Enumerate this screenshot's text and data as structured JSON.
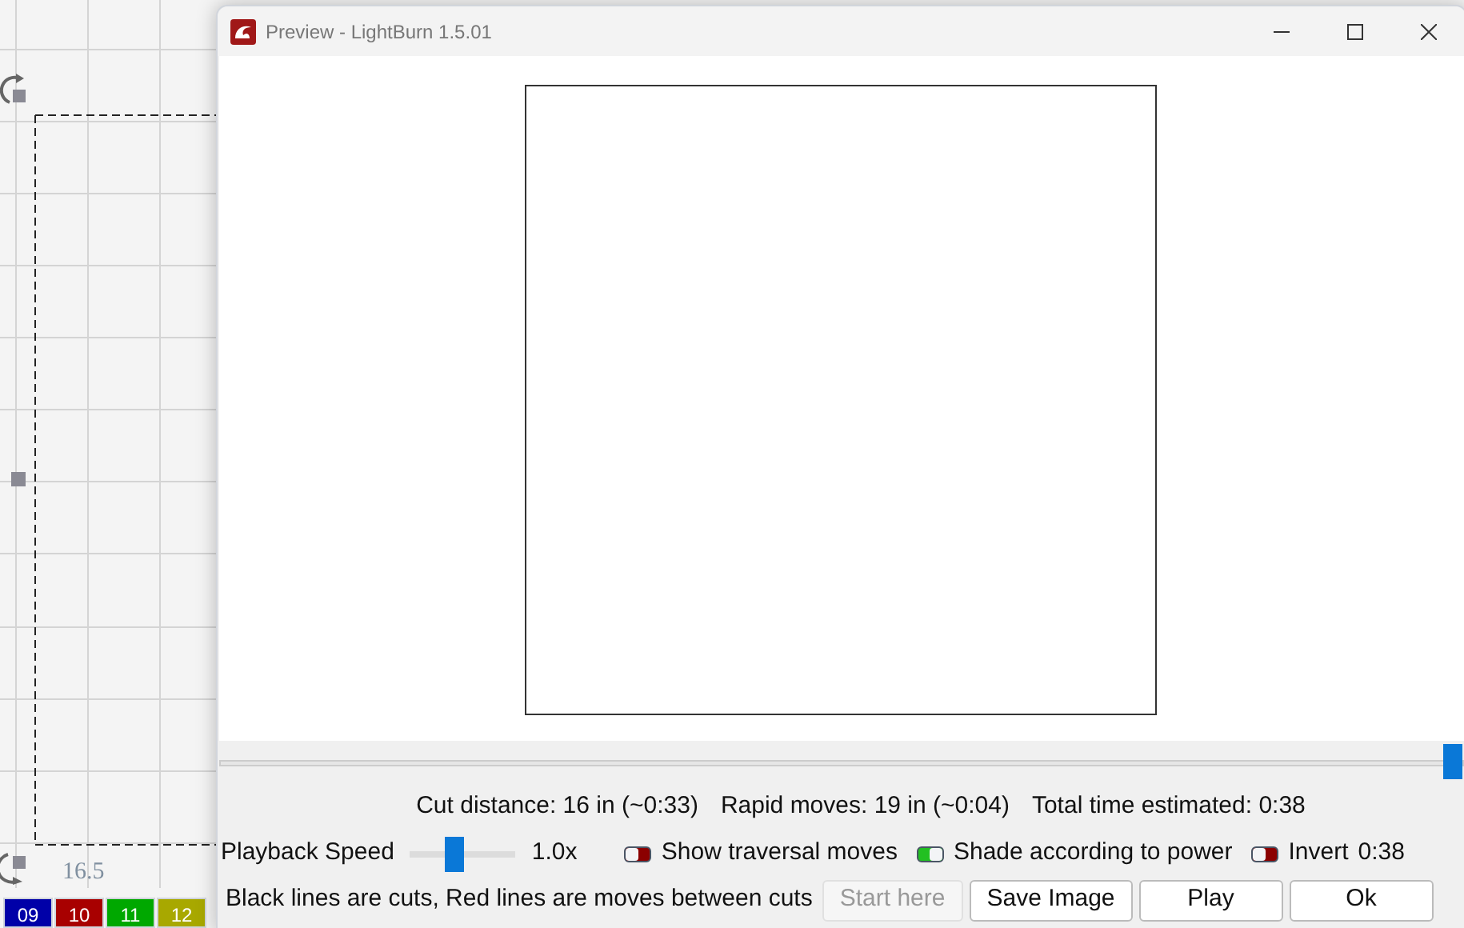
{
  "canvas": {
    "ruler_label": "16.5",
    "palette": [
      {
        "label": "09",
        "color": "#0000a8"
      },
      {
        "label": "10",
        "color": "#a80000"
      },
      {
        "label": "11",
        "color": "#00a800"
      },
      {
        "label": "12",
        "color": "#a8a800"
      }
    ]
  },
  "window": {
    "title": "Preview - LightBurn 1.5.01"
  },
  "timeline": {
    "level": 1
  },
  "stats": [
    "Cut distance: 16 in (~0:33)",
    "Rapid moves: 19 in (~0:04)",
    "Total time estimated: 0:38"
  ],
  "playback": {
    "label": "Playback Speed",
    "level": 0.4,
    "reading": "1.0x"
  },
  "toggles": [
    {
      "label": "Show traversal moves",
      "on": false
    },
    {
      "label": "Shade according to power",
      "on": true
    },
    {
      "label": "Invert",
      "on": false
    }
  ],
  "time": "0:38",
  "legend": "Black lines are cuts, Red lines are moves between cuts",
  "buttons": [
    {
      "label": "Start here",
      "disabled": true
    },
    {
      "label": "Save Image",
      "disabled": false
    },
    {
      "label": "Play",
      "disabled": false
    },
    {
      "label": "Ok",
      "disabled": false
    }
  ]
}
